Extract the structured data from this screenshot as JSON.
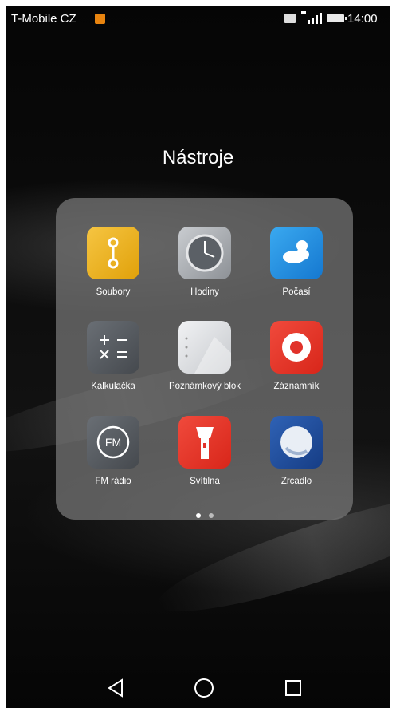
{
  "status_bar": {
    "carrier": "T-Mobile CZ",
    "time": "14:00"
  },
  "folder": {
    "title": "Nástroje",
    "apps": [
      {
        "label": "Soubory",
        "icon": "files-icon"
      },
      {
        "label": "Hodiny",
        "icon": "clock-icon"
      },
      {
        "label": "Počasí",
        "icon": "weather-icon"
      },
      {
        "label": "Kalkulačka",
        "icon": "calculator-icon"
      },
      {
        "label": "Poznámkový blok",
        "icon": "notepad-icon"
      },
      {
        "label": "Záznamník",
        "icon": "recorder-icon"
      },
      {
        "label": "FM rádio",
        "icon": "fm-radio-icon"
      },
      {
        "label": "Svítilna",
        "icon": "flashlight-icon"
      },
      {
        "label": "Zrcadlo",
        "icon": "mirror-icon"
      }
    ],
    "pages": 2,
    "current_page": 1
  },
  "nav_bar": {
    "buttons": [
      "back-icon",
      "home-icon",
      "recents-icon"
    ]
  }
}
